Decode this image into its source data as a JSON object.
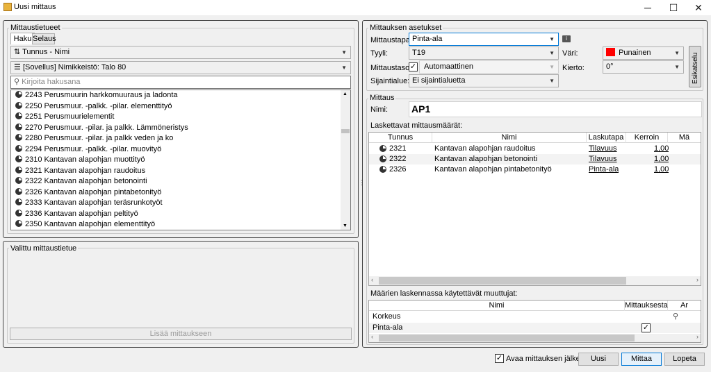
{
  "window": {
    "title": "Uusi mittaus",
    "minimize": "─",
    "maximize": "☐",
    "close": "✕"
  },
  "left": {
    "group_title": "Mittaustietueet",
    "tabs": [
      "Haku",
      "Selaus"
    ],
    "sort_combo": "Tunnus - Nimi",
    "library_combo": "[Sovellus] Nimikkeistö: Talo 80",
    "search_placeholder": "Kirjoita hakusana",
    "items": [
      "2243 Perusmuurin harkkomuuraus ja ladonta",
      "2250 Perusmuur. -palkk. -pilar. elementtityö",
      "2251 Perusmuurielementit",
      "2270 Perusmuur. -pilar. ja palkk.  Lämmöneristys",
      "2280 Perusmuur. -pilar. ja palkk  veden ja ko",
      "2294 Perusmuur. -palkk. -pilar.  muovityö",
      "2310 Kantavan alapohjan muottityö",
      "2321 Kantavan alapohjan raudoitus",
      "2322 Kantavan alapohjan betonointi",
      "2326 Kantavan alapohjan pintabetonityö",
      "2333 Kantavan alapohjan teräsrunkotyöt",
      "2336 Kantavan alapohjan peltityö",
      "2350 Kantavan alapohjan elementtityö"
    ],
    "selected_group_title": "Valittu mittaustietue",
    "add_button": "Lisää mittaukseen"
  },
  "right": {
    "settings_title": "Mittauksen asetukset",
    "labels": {
      "method": "Mittaustapa:",
      "style": "Tyyli:",
      "level": "Mittaustaso:",
      "location": "Sijaintialue:",
      "color": "Väri:",
      "rotation": "Kierto:"
    },
    "method_value": "Pinta-ala",
    "style_value": "T19",
    "level_value": "Automaattinen",
    "level_checked": true,
    "location_value": "Ei sijaintialuetta",
    "color_value": "Punainen",
    "color_hex": "#ff0000",
    "rotation_value": "0°",
    "preview_tab": "Esikatselu",
    "measurement_title": "Mittaus",
    "name_label": "Nimi:",
    "name_value": "AP1",
    "quantities_label": "Laskettavat mittausmäärät:",
    "quantities_headers": [
      "Tunnus",
      "Nimi",
      "Laskutapa",
      "Kerroin",
      "Mä"
    ],
    "quantities_rows": [
      {
        "code": "2321",
        "name": "Kantavan alapohjan raudoitus",
        "method": "Tilavuus",
        "factor": "1,00"
      },
      {
        "code": "2322",
        "name": "Kantavan alapohjan betonointi",
        "method": "Tilavuus",
        "factor": "1,00"
      },
      {
        "code": "2326",
        "name": "Kantavan alapohjan pintabetonityö",
        "method": "Pinta-ala",
        "factor": "1,00"
      }
    ],
    "variables_label": "Määrien laskennassa käytettävät muuttujat:",
    "variables_headers": [
      "Nimi",
      "Mittauksesta",
      "Ar"
    ],
    "variables_rows": [
      {
        "name": "Korkeus",
        "from_measurement": false
      },
      {
        "name": "Pinta-ala",
        "from_measurement": true
      }
    ]
  },
  "footer": {
    "open_after_label": "Avaa mittauksen jälkeen",
    "open_after_checked": true,
    "new_button": "Uusi",
    "measure_button": "Mittaa",
    "finish_button": "Lopeta"
  }
}
